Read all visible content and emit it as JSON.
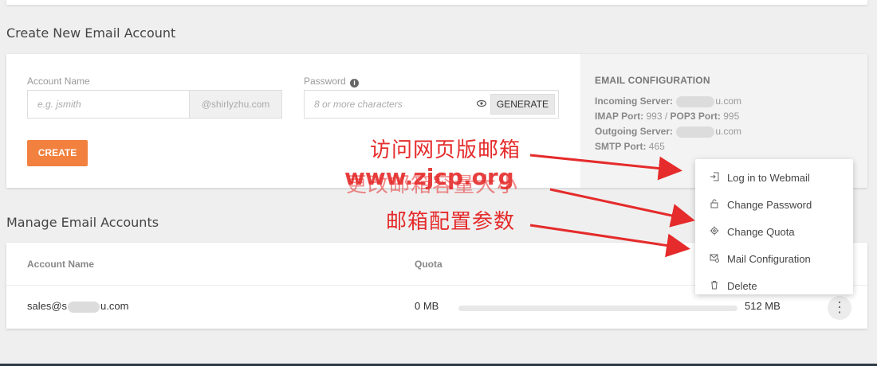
{
  "create_section": {
    "title": "Create New Email Account",
    "account_label": "Account Name",
    "account_placeholder": "e.g. jsmith",
    "domain_suffix": "@shirlyzhu.com",
    "password_label": "Password",
    "password_placeholder": "8 or more characters",
    "generate_label": "GENERATE",
    "create_label": "CREATE"
  },
  "email_config": {
    "heading": "EMAIL CONFIGURATION",
    "incoming_label": "Incoming Server:",
    "incoming_value_tail": "u.com",
    "imap_label": "IMAP Port:",
    "imap_value": "993",
    "separator": "/",
    "pop3_label": "POP3 Port:",
    "pop3_value": "995",
    "outgoing_label": "Outgoing Server:",
    "outgoing_value_tail": "u.com",
    "smtp_label": "SMTP Port:",
    "smtp_value": "465"
  },
  "manage_section": {
    "title": "Manage Email Accounts",
    "columns": [
      "Account Name",
      "Quota"
    ],
    "rows": [
      {
        "account_prefix": "sales@s",
        "account_suffix": "u.com",
        "used": "0 MB",
        "total": "512 MB",
        "usage_fraction": 0
      }
    ]
  },
  "context_menu": {
    "items": [
      {
        "label": "Log in to Webmail",
        "icon": "login-icon"
      },
      {
        "label": "Change Password",
        "icon": "lock-icon"
      },
      {
        "label": "Change Quota",
        "icon": "gear-icon"
      },
      {
        "label": "Mail Configuration",
        "icon": "mail-settings-icon"
      },
      {
        "label": "Delete",
        "icon": "trash-icon"
      }
    ]
  },
  "annotations": {
    "webmail": "访问网页版邮箱",
    "quota": "更改邮箱容量大小",
    "config": "邮箱配置参数",
    "watermark": "www.zjcp.org"
  },
  "colors": {
    "accent": "#f2803e",
    "annotation": "#e52b2b"
  }
}
